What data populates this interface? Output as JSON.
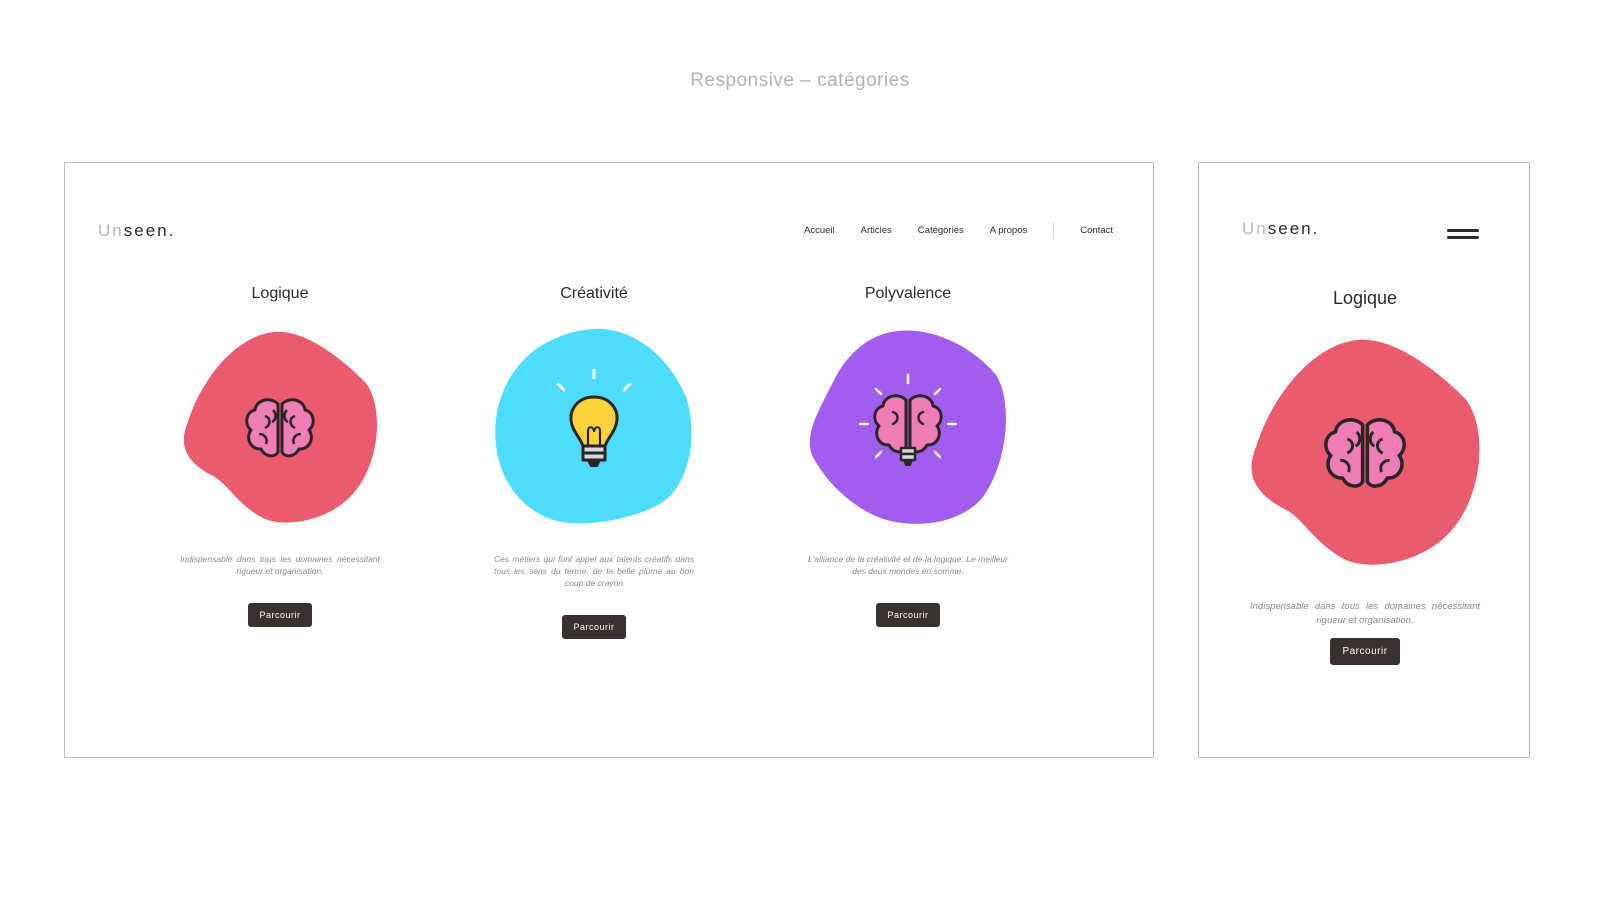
{
  "page_title": "Responsive – catégories",
  "logo": {
    "part1": "Un",
    "part2": "seen."
  },
  "nav": [
    "Accueil",
    "Articles",
    "Catégories",
    "A propos",
    "Contact"
  ],
  "categories": [
    {
      "title": "Logique",
      "color": "#ec5a6f",
      "icon": "brain-icon",
      "description": "Indispensable dans tous les domaines nécessitant rigueur et organisation.",
      "button": "Parcourir"
    },
    {
      "title": "Créativité",
      "color": "#4ddcfb",
      "icon": "lightbulb-icon",
      "description": "Ces métiers qui font appel aux talents créatifs dans tous les sens du terme, de la belle plume au bon coup de crayon",
      "button": "Parcourir"
    },
    {
      "title": "Polyvalence",
      "color": "#a35cf0",
      "icon": "brain-bulb-icon",
      "description": "L'alliance de la créativité et de la logique. Le meilleur des deux mondes en somme.",
      "button": "Parcourir"
    }
  ],
  "mobile": {
    "title": "Logique",
    "color": "#ec5a6f",
    "icon": "brain-icon",
    "description": "Indispensable dans tous les domaines nécessitant rigueur et organisation.",
    "button": "Parcourir"
  }
}
